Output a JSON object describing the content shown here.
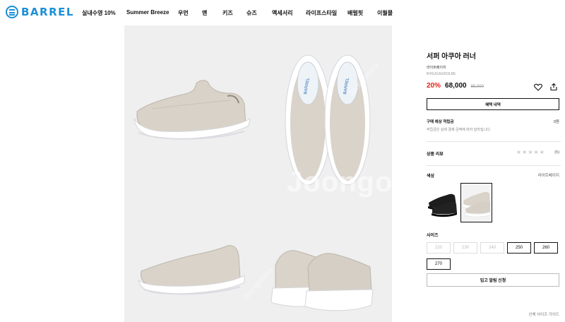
{
  "brand": {
    "name": "BARREL",
    "color": "#1b8fd8"
  },
  "nav": {
    "items": [
      {
        "label": "실내수영 10%"
      },
      {
        "label": "Summer Breeze"
      },
      {
        "label": "우먼"
      },
      {
        "label": "맨"
      },
      {
        "label": "키즈"
      },
      {
        "label": "슈즈"
      },
      {
        "label": "액세서리"
      },
      {
        "label": "라이프스타일"
      },
      {
        "label": "배럴핏"
      },
      {
        "label": "이월몰"
      }
    ]
  },
  "gallery": {
    "watermark": "Joongonara",
    "watermark_small": "Joongonara",
    "insole_logo": "BARREL"
  },
  "product": {
    "title": "서퍼 아쿠아 러너",
    "color_text": "라이트베이지",
    "code": "B4SUGAS003LBE",
    "discount": "20%",
    "price": "68,000",
    "original_price": "85,000",
    "discount_color": "#e2231a",
    "icons": [
      "heart-icon",
      "share-icon"
    ],
    "benefit_button": "혜택 내역",
    "points": {
      "label": "구매 예상 적립금",
      "value": "0원",
      "note": "적립금은 실제 결제 금액에 따라 달라집니다."
    },
    "review": {
      "label": "상품 리뷰",
      "stars": "★★★★★",
      "count": "(5)"
    },
    "color": {
      "label": "색상",
      "selected": "라이트베이지"
    },
    "size": {
      "label": "사이즈",
      "options": [
        {
          "value": "220",
          "available": false
        },
        {
          "value": "230",
          "available": false
        },
        {
          "value": "240",
          "available": false
        },
        {
          "value": "250",
          "available": true
        },
        {
          "value": "260",
          "available": true
        },
        {
          "value": "270",
          "available": true
        }
      ]
    },
    "restock_button": "입고 알림 신청",
    "size_guide": "신체 사이즈 가이드"
  }
}
